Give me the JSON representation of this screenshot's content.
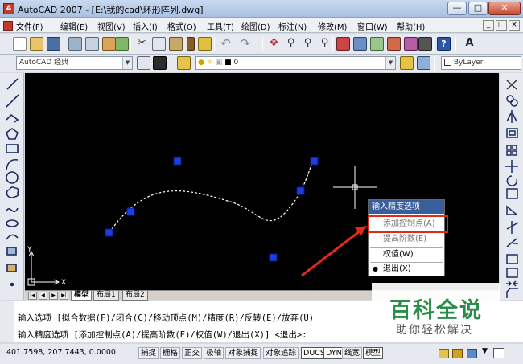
{
  "window": {
    "title": "AutoCAD 2007 - [E:\\我的cad\\环形阵列.dwg]",
    "app_icon": "A"
  },
  "menu": {
    "items": [
      "文件(F)",
      "编辑(E)",
      "视图(V)",
      "插入(I)",
      "格式(O)",
      "工具(T)",
      "绘图(D)",
      "标注(N)",
      "修改(M)",
      "窗口(W)",
      "帮助(H)"
    ]
  },
  "toolbar": {
    "workspace": "AutoCAD 经典",
    "layer_name": "0",
    "linetype": "ByLayer",
    "icons": [
      "new-icon",
      "open-icon",
      "save-icon",
      "plot-icon",
      "plot-preview-icon",
      "publish-icon",
      "cut-icon",
      "copy-icon",
      "paste-icon",
      "match-properties-icon",
      "block-editor-icon",
      "undo-icon",
      "redo-icon",
      "pan-icon",
      "zoom-realtime-icon",
      "zoom-window-icon",
      "zoom-previous-icon",
      "properties-icon",
      "design-center-icon",
      "tool-palettes-icon",
      "sheet-set-icon",
      "markup-icon",
      "calculator-icon",
      "help-icon",
      "text-style-icon"
    ]
  },
  "left_tools": [
    "line-icon",
    "construction-line-icon",
    "polyline-icon",
    "polygon-icon",
    "rectangle-icon",
    "arc-icon",
    "circle-icon",
    "revision-cloud-icon",
    "spline-icon",
    "ellipse-icon",
    "ellipse-arc-icon",
    "insert-block-icon",
    "make-block-icon",
    "point-icon"
  ],
  "right_tools": [
    "erase-icon",
    "copy-object-icon",
    "mirror-icon",
    "offset-icon",
    "array-icon",
    "move-icon",
    "rotate-icon",
    "scale-icon",
    "stretch-icon",
    "trim-icon",
    "extend-icon",
    "break-at-point-icon",
    "break-icon",
    "join-icon",
    "chamfer-icon"
  ],
  "context_menu": {
    "title": "输入精度选项",
    "items": [
      {
        "label": "添加控制点(A)",
        "state": "highlighted"
      },
      {
        "label": "提高阶数(E)",
        "state": "normal"
      },
      {
        "label": "权值(W)",
        "state": "normal"
      },
      {
        "label": "退出(X)",
        "state": "checked"
      }
    ]
  },
  "layout_tabs": [
    "模型",
    "布局1",
    "布局2"
  ],
  "ucs": {
    "x_label": "X",
    "y_label": "Y"
  },
  "command": {
    "line1": "输入选项 [拟合数据(F)/闭合(C)/移动顶点(M)/精度(R)/反转(E)/放弃(U)",
    "line2": "输入精度选项 [添加控制点(A)/提高阶数(E)/权值(W)/退出(X)] <退出>: "
  },
  "status": {
    "coords": "401.7598,  207.7443,  0.0000",
    "toggles": [
      "捕捉",
      "栅格",
      "正交",
      "极轴",
      "对象捕捉",
      "对象追踪",
      "DUCS",
      "DYN",
      "线宽",
      "模型"
    ]
  },
  "watermark": {
    "main": "百科全说",
    "sub": "助你轻松解决"
  },
  "colors": {
    "grip": "#1c3de0",
    "annotation": "#e02a1a",
    "canvas": "#000000",
    "menu_title": "#3a5d9c",
    "watermark": "#2a8c49"
  }
}
